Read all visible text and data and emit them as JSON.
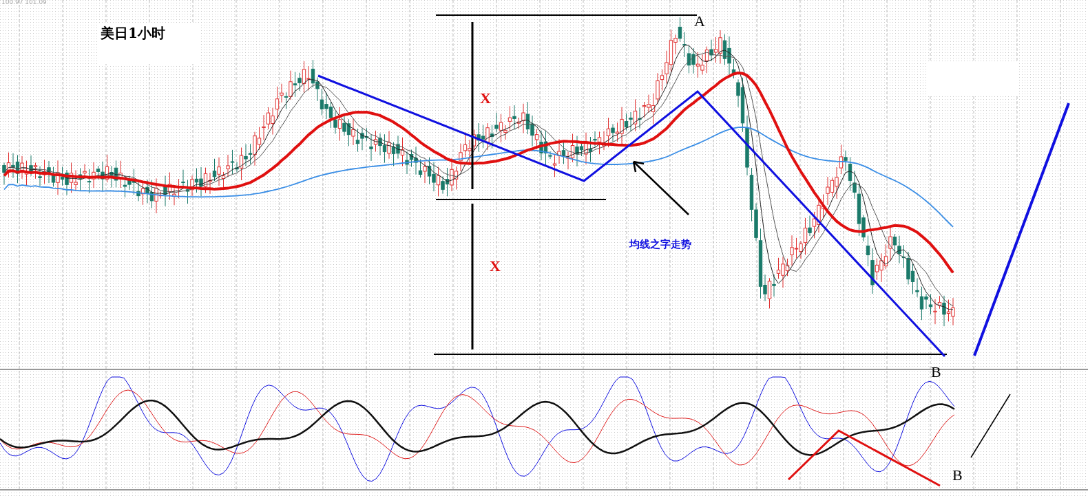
{
  "price_header": "100.97 101.09",
  "title": "美日1小时",
  "labels": [
    {
      "kind": "point",
      "text": "A"
    },
    {
      "kind": "measure",
      "text": "X"
    },
    {
      "kind": "measure",
      "text": "X"
    },
    {
      "kind": "note",
      "text": "均线之字走势"
    },
    {
      "kind": "point",
      "text": "B"
    },
    {
      "kind": "point",
      "text": "B"
    }
  ]
}
